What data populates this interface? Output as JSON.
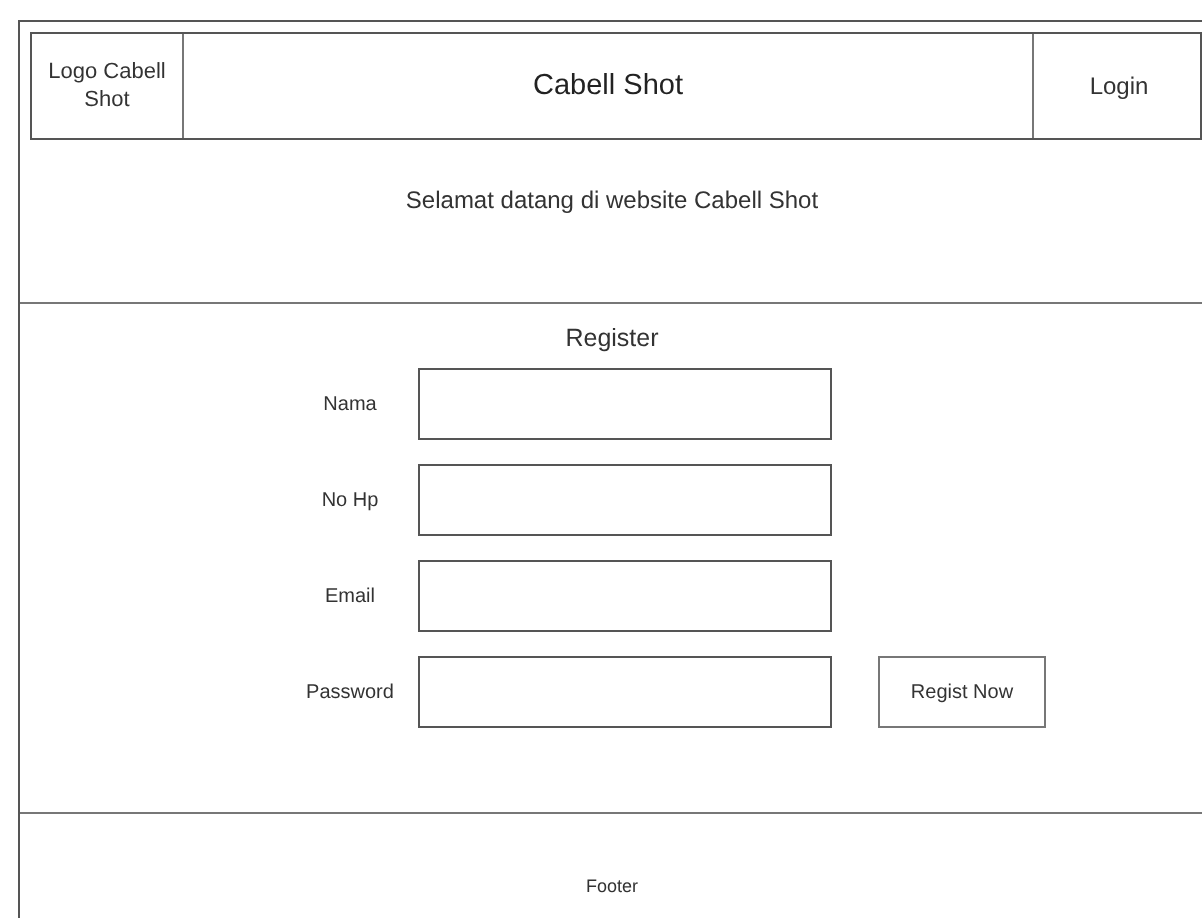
{
  "header": {
    "logo": "Logo Cabell Shot",
    "title": "Cabell Shot",
    "login": "Login"
  },
  "welcome": "Selamat datang di website Cabell Shot",
  "register": {
    "title": "Register",
    "fields": [
      {
        "label": "Nama"
      },
      {
        "label": "No Hp"
      },
      {
        "label": "Email"
      },
      {
        "label": "Password"
      }
    ],
    "button": "Regist Now"
  },
  "footer": "Footer"
}
